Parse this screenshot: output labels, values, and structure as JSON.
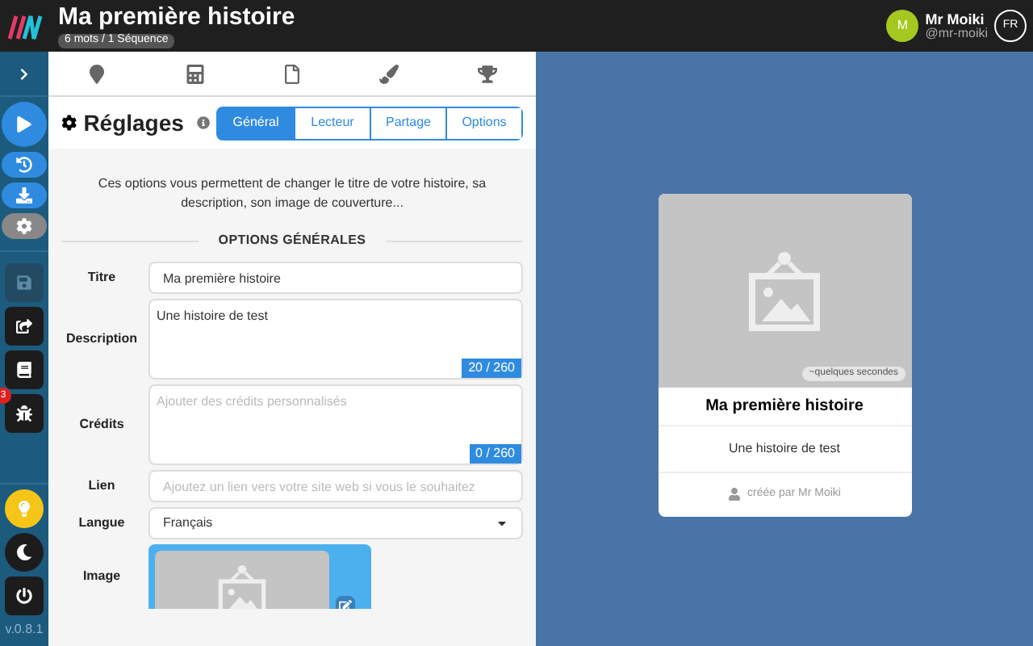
{
  "header": {
    "title": "Ma première histoire",
    "subtitle": "6 mots / 1 Séquence",
    "user": {
      "initial": "M",
      "name": "Mr Moiki",
      "handle": "@mr-moiki"
    },
    "language": "FR"
  },
  "sidebar": {
    "top": [
      {
        "kind": "primary"
      },
      {
        "kind": "secondary"
      },
      {
        "kind": "secondary"
      },
      {
        "kind": "muted"
      }
    ],
    "tools": [
      {
        "disabled": true
      },
      {
        "disabled": false
      },
      {
        "disabled": false
      },
      {
        "disabled": false,
        "badge": "3"
      }
    ],
    "bottom": [
      {
        "kind": "yellow"
      },
      {
        "kind": "dark"
      },
      {
        "kind": "dark-square"
      }
    ],
    "version": "v.0.8.1"
  },
  "icon_tabs": [
    {
      "selected": false
    },
    {
      "selected": false
    },
    {
      "selected": false
    },
    {
      "selected": false
    },
    {
      "selected": false
    }
  ],
  "settings": {
    "title": "Réglages",
    "tabs": [
      {
        "label": "Général",
        "selected": true
      },
      {
        "label": "Lecteur",
        "selected": false
      },
      {
        "label": "Partage",
        "selected": false
      },
      {
        "label": "Options",
        "selected": false
      }
    ],
    "intro": "Ces options vous permettent de changer le titre de votre histoire, sa description, son image de couverture...",
    "section": "OPTIONS GÉNÉRALES",
    "fields": [
      {
        "label": "Titre",
        "kind": "text",
        "value": "Ma première histoire"
      },
      {
        "label": "Description",
        "kind": "textarea",
        "value": "Une histoire de test",
        "counter": "20 / 260"
      },
      {
        "label": "Crédits",
        "kind": "textarea",
        "placeholder": "Ajouter des crédits personnalisés",
        "counter": "0 / 260"
      },
      {
        "label": "Lien",
        "kind": "text",
        "placeholder": "Ajoutez un lien vers votre site web si vous le souhaitez"
      },
      {
        "label": "Langue",
        "kind": "select",
        "value": "Français"
      },
      {
        "label": "Image",
        "kind": "image"
      }
    ]
  },
  "preview": {
    "time": "~quelques secondes",
    "title": "Ma première histoire",
    "description": "Une histoire de test",
    "author": "créée par Mr Moiki"
  }
}
